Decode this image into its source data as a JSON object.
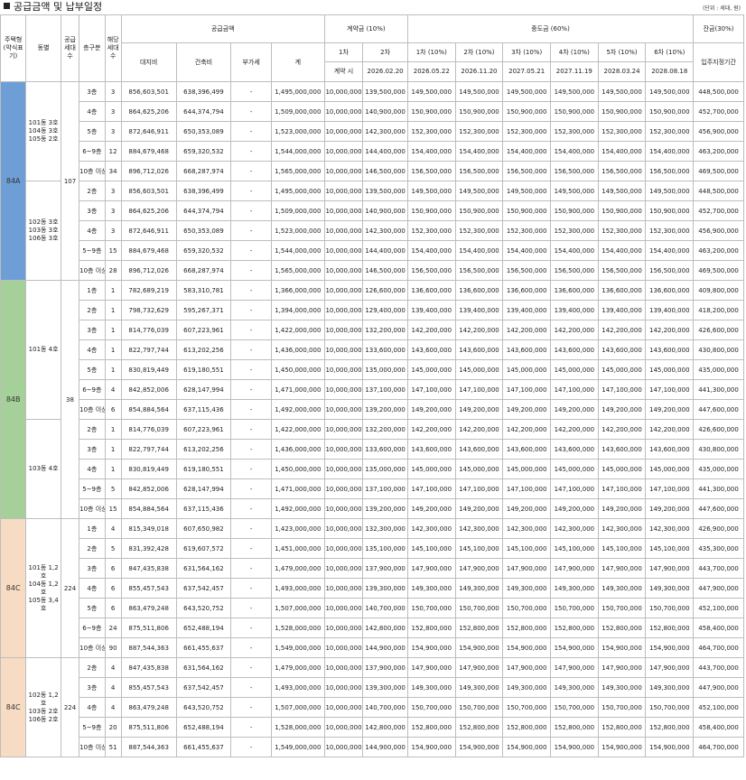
{
  "title": "공급금액 및 납부일정",
  "unit": "(단위 : 세대, 원)",
  "header": {
    "type": "주택형(약식표기)",
    "dong": "동별",
    "supply_units": "공급세대수",
    "floor": "층구분",
    "units": "해당세대수",
    "supply_amount": "공급금액",
    "land": "대지비",
    "building": "건축비",
    "vat": "부가세",
    "total": "계",
    "deposit": "계약금 (10%)",
    "deposit_1": "1차",
    "deposit_2": "2차",
    "deposit_1_date": "계약 시",
    "deposit_2_date": "2026.02.20",
    "middle": "중도금 (60%)",
    "middle_labels": [
      "1차 (10%)",
      "2차 (10%)",
      "3차 (10%)",
      "4차 (10%)",
      "5차 (10%)",
      "6차 (10%)"
    ],
    "middle_dates": [
      "2026.05.22",
      "2026.11.20",
      "2027.05.21",
      "2027.11.19",
      "2028.03.24",
      "2028.08.18"
    ],
    "balance": "잔금(30%)",
    "balance_date": "입주지정기간"
  },
  "groups": [
    {
      "type": "84A",
      "color": "#6d9fd6",
      "supply": "107",
      "dongs": [
        {
          "dong": "101동 3호\n104동 3호\n105동 2호",
          "rows": [
            {
              "floor": "3층",
              "units": "3",
              "land": "856,603,501",
              "bld": "638,396,499",
              "vat": "-",
              "total": "1,495,000,000",
              "d1": "10,000,000",
              "d2": "139,500,000",
              "m": "149,500,000",
              "bal": "448,500,000"
            },
            {
              "floor": "4층",
              "units": "3",
              "land": "864,625,206",
              "bld": "644,374,794",
              "vat": "-",
              "total": "1,509,000,000",
              "d1": "10,000,000",
              "d2": "140,900,000",
              "m": "150,900,000",
              "bal": "452,700,000"
            },
            {
              "floor": "5층",
              "units": "3",
              "land": "872,646,911",
              "bld": "650,353,089",
              "vat": "-",
              "total": "1,523,000,000",
              "d1": "10,000,000",
              "d2": "142,300,000",
              "m": "152,300,000",
              "bal": "456,900,000"
            },
            {
              "floor": "6~9층",
              "units": "12",
              "land": "884,679,468",
              "bld": "659,320,532",
              "vat": "-",
              "total": "1,544,000,000",
              "d1": "10,000,000",
              "d2": "144,400,000",
              "m": "154,400,000",
              "bal": "463,200,000"
            },
            {
              "floor": "10층 이상",
              "units": "34",
              "land": "896,712,026",
              "bld": "668,287,974",
              "vat": "-",
              "total": "1,565,000,000",
              "d1": "10,000,000",
              "d2": "146,500,000",
              "m": "156,500,000",
              "bal": "469,500,000"
            }
          ]
        },
        {
          "dong": "102동 3호\n103동 3호\n106동 3호",
          "rows": [
            {
              "floor": "2층",
              "units": "3",
              "land": "856,603,501",
              "bld": "638,396,499",
              "vat": "-",
              "total": "1,495,000,000",
              "d1": "10,000,000",
              "d2": "139,500,000",
              "m": "149,500,000",
              "bal": "448,500,000"
            },
            {
              "floor": "3층",
              "units": "3",
              "land": "864,625,206",
              "bld": "644,374,794",
              "vat": "-",
              "total": "1,509,000,000",
              "d1": "10,000,000",
              "d2": "140,900,000",
              "m": "150,900,000",
              "bal": "452,700,000"
            },
            {
              "floor": "4층",
              "units": "3",
              "land": "872,646,911",
              "bld": "650,353,089",
              "vat": "-",
              "total": "1,523,000,000",
              "d1": "10,000,000",
              "d2": "142,300,000",
              "m": "152,300,000",
              "bal": "456,900,000"
            },
            {
              "floor": "5~9층",
              "units": "15",
              "land": "884,679,468",
              "bld": "659,320,532",
              "vat": "-",
              "total": "1,544,000,000",
              "d1": "10,000,000",
              "d2": "144,400,000",
              "m": "154,400,000",
              "bal": "463,200,000"
            },
            {
              "floor": "10층 이상",
              "units": "28",
              "land": "896,712,026",
              "bld": "668,287,974",
              "vat": "-",
              "total": "1,565,000,000",
              "d1": "10,000,000",
              "d2": "146,500,000",
              "m": "156,500,000",
              "bal": "469,500,000"
            }
          ]
        }
      ]
    },
    {
      "type": "84B",
      "color": "#a5d09a",
      "supply": "38",
      "dongs": [
        {
          "dong": "101동 4호",
          "rows": [
            {
              "floor": "1층",
              "units": "1",
              "land": "782,689,219",
              "bld": "583,310,781",
              "vat": "-",
              "total": "1,366,000,000",
              "d1": "10,000,000",
              "d2": "126,600,000",
              "m": "136,600,000",
              "bal": "409,800,000"
            },
            {
              "floor": "2층",
              "units": "1",
              "land": "798,732,629",
              "bld": "595,267,371",
              "vat": "-",
              "total": "1,394,000,000",
              "d1": "10,000,000",
              "d2": "129,400,000",
              "m": "139,400,000",
              "bal": "418,200,000"
            },
            {
              "floor": "3층",
              "units": "1",
              "land": "814,776,039",
              "bld": "607,223,961",
              "vat": "-",
              "total": "1,422,000,000",
              "d1": "10,000,000",
              "d2": "132,200,000",
              "m": "142,200,000",
              "bal": "426,600,000"
            },
            {
              "floor": "4층",
              "units": "1",
              "land": "822,797,744",
              "bld": "613,202,256",
              "vat": "-",
              "total": "1,436,000,000",
              "d1": "10,000,000",
              "d2": "133,600,000",
              "m": "143,600,000",
              "bal": "430,800,000"
            },
            {
              "floor": "5층",
              "units": "1",
              "land": "830,819,449",
              "bld": "619,180,551",
              "vat": "-",
              "total": "1,450,000,000",
              "d1": "10,000,000",
              "d2": "135,000,000",
              "m": "145,000,000",
              "bal": "435,000,000"
            },
            {
              "floor": "6~9층",
              "units": "4",
              "land": "842,852,006",
              "bld": "628,147,994",
              "vat": "-",
              "total": "1,471,000,000",
              "d1": "10,000,000",
              "d2": "137,100,000",
              "m": "147,100,000",
              "bal": "441,300,000"
            },
            {
              "floor": "10층 이상",
              "units": "6",
              "land": "854,884,564",
              "bld": "637,115,436",
              "vat": "-",
              "total": "1,492,000,000",
              "d1": "10,000,000",
              "d2": "139,200,000",
              "m": "149,200,000",
              "bal": "447,600,000"
            }
          ]
        },
        {
          "dong": "103동 4호",
          "rows": [
            {
              "floor": "2층",
              "units": "1",
              "land": "814,776,039",
              "bld": "607,223,961",
              "vat": "-",
              "total": "1,422,000,000",
              "d1": "10,000,000",
              "d2": "132,200,000",
              "m": "142,200,000",
              "bal": "426,600,000"
            },
            {
              "floor": "3층",
              "units": "1",
              "land": "822,797,744",
              "bld": "613,202,256",
              "vat": "-",
              "total": "1,436,000,000",
              "d1": "10,000,000",
              "d2": "133,600,000",
              "m": "143,600,000",
              "bal": "430,800,000"
            },
            {
              "floor": "4층",
              "units": "1",
              "land": "830,819,449",
              "bld": "619,180,551",
              "vat": "-",
              "total": "1,450,000,000",
              "d1": "10,000,000",
              "d2": "135,000,000",
              "m": "145,000,000",
              "bal": "435,000,000"
            },
            {
              "floor": "5~9층",
              "units": "5",
              "land": "842,852,006",
              "bld": "628,147,994",
              "vat": "-",
              "total": "1,471,000,000",
              "d1": "10,000,000",
              "d2": "137,100,000",
              "m": "147,100,000",
              "bal": "441,300,000"
            },
            {
              "floor": "10층 이상",
              "units": "15",
              "land": "854,884,564",
              "bld": "637,115,436",
              "vat": "-",
              "total": "1,492,000,000",
              "d1": "10,000,000",
              "d2": "139,200,000",
              "m": "149,200,000",
              "bal": "447,600,000"
            }
          ]
        }
      ]
    },
    {
      "type": "84C",
      "color": "#f7dcc3",
      "supply": "224",
      "dongs": [
        {
          "dong": "101동 1,2호\n104동 1,2호\n105동 3,4호",
          "rows": [
            {
              "floor": "1층",
              "units": "4",
              "land": "815,349,018",
              "bld": "607,650,982",
              "vat": "-",
              "total": "1,423,000,000",
              "d1": "10,000,000",
              "d2": "132,300,000",
              "m": "142,300,000",
              "bal": "426,900,000"
            },
            {
              "floor": "2층",
              "units": "5",
              "land": "831,392,428",
              "bld": "619,607,572",
              "vat": "-",
              "total": "1,451,000,000",
              "d1": "10,000,000",
              "d2": "135,100,000",
              "m": "145,100,000",
              "bal": "435,300,000"
            },
            {
              "floor": "3층",
              "units": "6",
              "land": "847,435,838",
              "bld": "631,564,162",
              "vat": "-",
              "total": "1,479,000,000",
              "d1": "10,000,000",
              "d2": "137,900,000",
              "m": "147,900,000",
              "bal": "443,700,000"
            },
            {
              "floor": "4층",
              "units": "6",
              "land": "855,457,543",
              "bld": "637,542,457",
              "vat": "-",
              "total": "1,493,000,000",
              "d1": "10,000,000",
              "d2": "139,300,000",
              "m": "149,300,000",
              "bal": "447,900,000"
            },
            {
              "floor": "5층",
              "units": "6",
              "land": "863,479,248",
              "bld": "643,520,752",
              "vat": "-",
              "total": "1,507,000,000",
              "d1": "10,000,000",
              "d2": "140,700,000",
              "m": "150,700,000",
              "bal": "452,100,000"
            },
            {
              "floor": "6~9층",
              "units": "24",
              "land": "875,511,806",
              "bld": "652,488,194",
              "vat": "-",
              "total": "1,528,000,000",
              "d1": "10,000,000",
              "d2": "142,800,000",
              "m": "152,800,000",
              "bal": "458,400,000"
            },
            {
              "floor": "10층 이상",
              "units": "90",
              "land": "887,544,363",
              "bld": "661,455,637",
              "vat": "-",
              "total": "1,549,000,000",
              "d1": "10,000,000",
              "d2": "144,900,000",
              "m": "154,900,000",
              "bal": "464,700,000"
            }
          ]
        }
      ]
    },
    {
      "type": "84C",
      "color": "#f7dcc3",
      "supply": "224",
      "dongs": [
        {
          "dong": "102동 1,2호\n103동 2호\n106동 2호",
          "rows": [
            {
              "floor": "2층",
              "units": "4",
              "land": "847,435,838",
              "bld": "631,564,162",
              "vat": "-",
              "total": "1,479,000,000",
              "d1": "10,000,000",
              "d2": "137,900,000",
              "m": "147,900,000",
              "bal": "443,700,000"
            },
            {
              "floor": "3층",
              "units": "4",
              "land": "855,457,543",
              "bld": "637,542,457",
              "vat": "-",
              "total": "1,493,000,000",
              "d1": "10,000,000",
              "d2": "139,300,000",
              "m": "149,300,000",
              "bal": "447,900,000"
            },
            {
              "floor": "4층",
              "units": "4",
              "land": "863,479,248",
              "bld": "643,520,752",
              "vat": "-",
              "total": "1,507,000,000",
              "d1": "10,000,000",
              "d2": "140,700,000",
              "m": "150,700,000",
              "bal": "452,100,000"
            },
            {
              "floor": "5~9층",
              "units": "20",
              "land": "875,511,806",
              "bld": "652,488,194",
              "vat": "-",
              "total": "1,528,000,000",
              "d1": "10,000,000",
              "d2": "142,800,000",
              "m": "152,800,000",
              "bal": "458,400,000"
            },
            {
              "floor": "10층 이상",
              "units": "51",
              "land": "887,544,363",
              "bld": "661,455,637",
              "vat": "-",
              "total": "1,549,000,000",
              "d1": "10,000,000",
              "d2": "144,900,000",
              "m": "154,900,000",
              "bal": "464,700,000"
            }
          ]
        }
      ]
    }
  ]
}
